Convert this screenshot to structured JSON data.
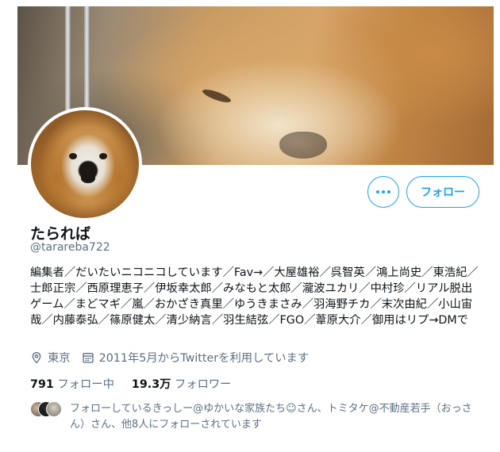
{
  "profile": {
    "name": "たられば",
    "handle": "@tarareba722",
    "bio": "編集者／だいたいニコニコしています／Fav→／大屋雄裕／呉智英／鴻上尚史／東浩紀／士郎正宗／西原理恵子／伊坂幸太郎／みなもと太郎／瀧波ユカリ／中村珍／リアル脱出ゲーム／まどマギ／嵐／おかざき真里／ゆうきまさみ／羽海野チカ／末次由紀／小山宙哉／内藤泰弘／篠原健太／清少納言／羽生結弦／FGO／葦原大介／御用はリプ→DMで",
    "location": "東京",
    "joined": "2011年5月からTwitterを利用しています"
  },
  "actions": {
    "follow_label": "フォロー"
  },
  "stats": {
    "following_count": "791",
    "following_label": "フォロー中",
    "followers_count": "19.3万",
    "followers_label": "フォロワー"
  },
  "followed_by": {
    "text": "フォローしているきっしー@ゆかいな家族たち☺さん、トミタケ@不動産若手（おっさん）さん、他8人にフォローされています"
  },
  "icons": [
    "more-icon",
    "location-icon",
    "calendar-icon"
  ],
  "colors": {
    "accent": "#1da1f2",
    "secondary_text": "#5b7083",
    "primary_text": "#0f1419"
  }
}
